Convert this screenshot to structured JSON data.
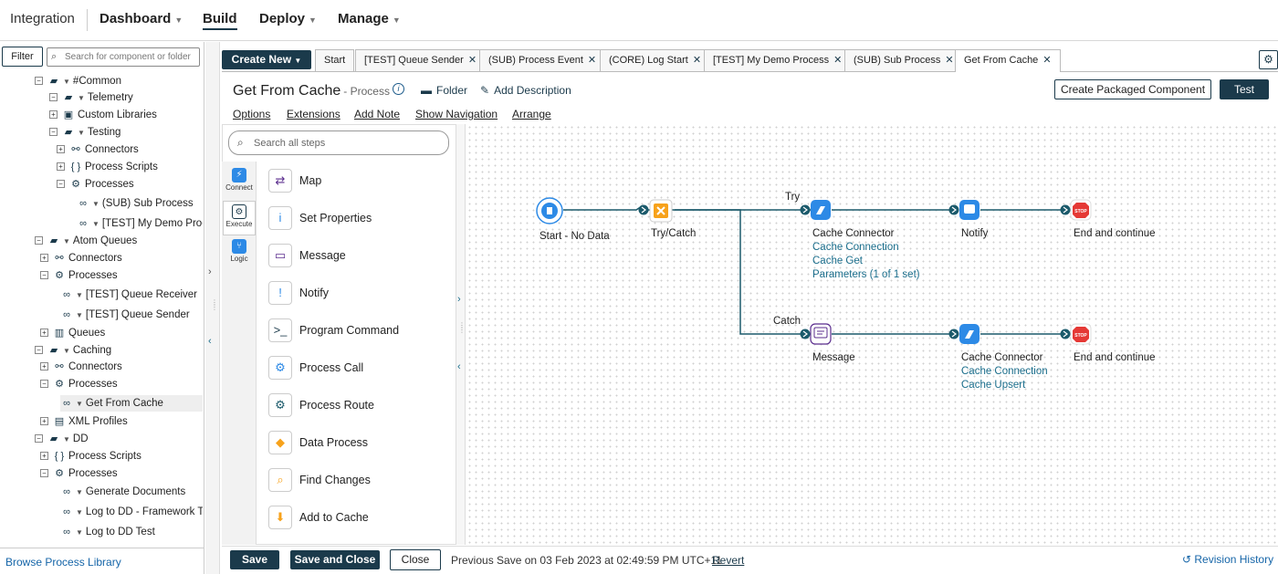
{
  "topnav": {
    "brand": "Integration",
    "items": [
      "Dashboard",
      "Build",
      "Deploy",
      "Manage"
    ],
    "active": "Build"
  },
  "tree": {
    "filter_label": "Filter",
    "search_placeholder": "Search for component or folder",
    "rows": [
      {
        "label": "#Common",
        "type": "folder"
      },
      {
        "label": "Telemetry",
        "type": "folder"
      },
      {
        "label": "Custom Libraries",
        "type": "library"
      },
      {
        "label": "Testing",
        "type": "folder"
      },
      {
        "label": "Connectors",
        "type": "connector"
      },
      {
        "label": "Process Scripts",
        "type": "script"
      },
      {
        "label": "Processes",
        "type": "process"
      },
      {
        "label": "(SUB) Sub Process",
        "type": "process-item"
      },
      {
        "label": "[TEST] My Demo Process",
        "type": "process-item"
      },
      {
        "label": "Atom Queues",
        "type": "folder"
      },
      {
        "label": "Connectors",
        "type": "connector"
      },
      {
        "label": "Processes",
        "type": "process"
      },
      {
        "label": "[TEST] Queue Receiver",
        "type": "process-item"
      },
      {
        "label": "[TEST] Queue Sender",
        "type": "process-item"
      },
      {
        "label": "Queues",
        "type": "queue"
      },
      {
        "label": "Caching",
        "type": "folder"
      },
      {
        "label": "Connectors",
        "type": "connector"
      },
      {
        "label": "Processes",
        "type": "process"
      },
      {
        "label": "Get From Cache",
        "type": "process-item"
      },
      {
        "label": "XML Profiles",
        "type": "xml"
      },
      {
        "label": "DD",
        "type": "folder"
      },
      {
        "label": "Process Scripts",
        "type": "script"
      },
      {
        "label": "Processes",
        "type": "process"
      },
      {
        "label": "Generate Documents",
        "type": "process-item"
      },
      {
        "label": "Log to DD - Framework Test",
        "type": "process-item"
      },
      {
        "label": "Log to DD Test",
        "type": "process-item"
      }
    ],
    "browse_library": "Browse Process Library"
  },
  "tabs": {
    "create_new": "Create New",
    "items": [
      {
        "label": "Start",
        "closable": false
      },
      {
        "label": "[TEST] Queue Sender",
        "closable": true
      },
      {
        "label": "(SUB) Process Event",
        "closable": true
      },
      {
        "label": "(CORE) Log Start",
        "closable": true
      },
      {
        "label": "[TEST] My Demo Process",
        "closable": true
      },
      {
        "label": "(SUB) Sub Process",
        "closable": true
      },
      {
        "label": "Get From Cache",
        "closable": true
      }
    ],
    "close_glyph": "✕"
  },
  "process": {
    "title": "Get From Cache",
    "type_label": "- Process",
    "folder_label": "Folder",
    "add_description": "Add Description",
    "create_packaged": "Create Packaged Component",
    "test_label": "Test",
    "menu": [
      "Options",
      "Extensions",
      "Add Note",
      "Show Navigation",
      "Arrange"
    ]
  },
  "palette": {
    "search_placeholder": "Search all steps",
    "categories": [
      "Connect",
      "Execute",
      "Logic"
    ],
    "active_category": "Execute",
    "steps": [
      "Map",
      "Set Properties",
      "Message",
      "Notify",
      "Program Command",
      "Process Call",
      "Process Route",
      "Data Process",
      "Find Changes",
      "Add to Cache"
    ]
  },
  "canvas": {
    "nodes": {
      "start": {
        "label": "Start - No Data"
      },
      "trycatch": {
        "label": "Try/Catch"
      },
      "try_label": "Try",
      "catch_label": "Catch",
      "cache1": {
        "label": "Cache Connector",
        "links": [
          "Cache Connection",
          "Cache Get",
          "Parameters (1 of 1 set)"
        ]
      },
      "notify": {
        "label": "Notify"
      },
      "end1": {
        "label": "End and continue"
      },
      "message": {
        "label": "Message"
      },
      "cache2": {
        "label": "Cache Connector",
        "links": [
          "Cache Connection",
          "Cache Upsert"
        ]
      },
      "end2": {
        "label": "End and continue"
      },
      "stop_text": "STOP"
    }
  },
  "footer": {
    "save": "Save",
    "save_close": "Save and Close",
    "close": "Close",
    "previous_save": "Previous Save on 03 Feb 2023 at 02:49:59 PM UTC+11",
    "revert": "Revert",
    "revision_history": "Revision History"
  },
  "colors": {
    "primary": "#1b3a4b",
    "link": "#1565a8",
    "node_blue": "#2d8ae6",
    "stop_red": "#e53935",
    "connector_teal": "#1b5a6b"
  }
}
